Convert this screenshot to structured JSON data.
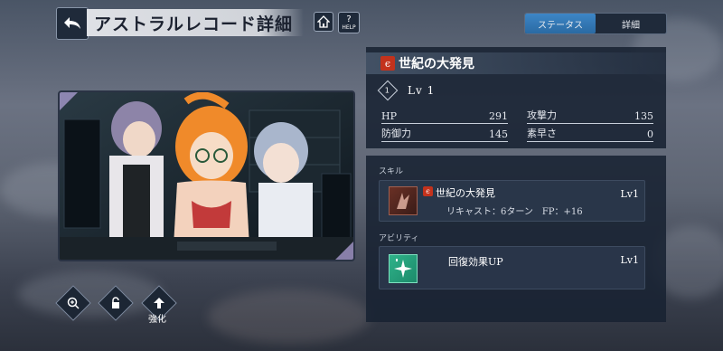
{
  "header": {
    "title": "アストラルレコード詳細",
    "help_label": "HELP"
  },
  "tabs": [
    {
      "label": "ステータス",
      "active": true
    },
    {
      "label": "詳細",
      "active": false
    }
  ],
  "card": {
    "name": "世紀の大発見",
    "element_color": "#c3321c",
    "level_icon_text": "1",
    "level_text": "Lv 1"
  },
  "stats": {
    "hp": {
      "label": "HP",
      "value": "291"
    },
    "attack": {
      "label": "攻撃力",
      "value": "135"
    },
    "defense": {
      "label": "防御力",
      "value": "145"
    },
    "speed": {
      "label": "素早さ",
      "value": "0"
    }
  },
  "skill_section": {
    "label": "スキル",
    "name": "世紀の大発見",
    "level": "Lv1",
    "detail": "リキャスト：6ターン　FP：+16"
  },
  "ability_section": {
    "label": "アビリティ",
    "name": "回復効果UP",
    "level": "Lv1"
  },
  "actions": {
    "enhance_label": "強化"
  }
}
